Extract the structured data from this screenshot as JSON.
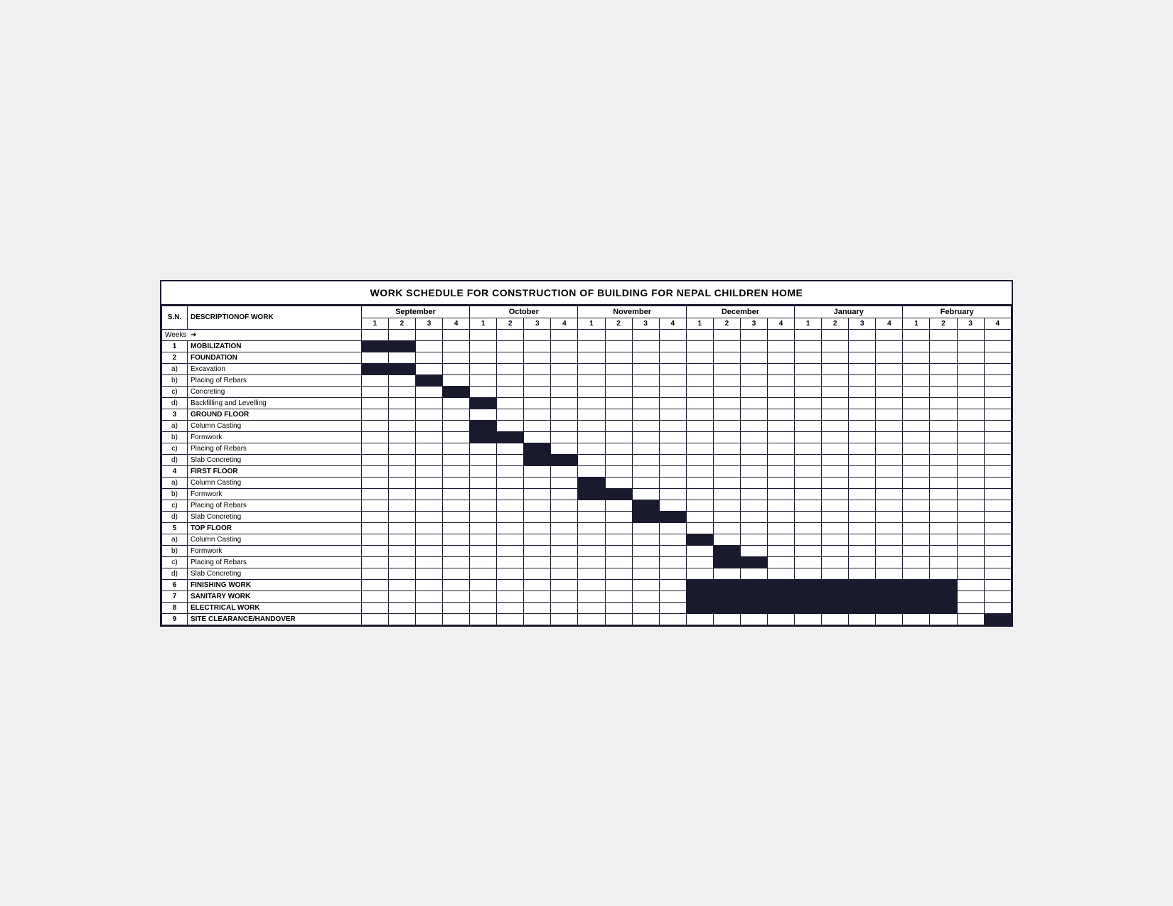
{
  "title": "WORK SCHEDULE FOR CONSTRUCTION OF BUILDING FOR NEPAL CHILDREN HOME",
  "header": {
    "sn_label": "S.N.",
    "desc_label": "DESCRIPTIONOF WORK",
    "weeks_label": "Weeks",
    "months": [
      "September",
      "October",
      "November",
      "December",
      "January",
      "February"
    ],
    "week_numbers": [
      1,
      2,
      3,
      4,
      1,
      2,
      3,
      4,
      1,
      2,
      3,
      4,
      1,
      2,
      3,
      4,
      1,
      2,
      3,
      4,
      1,
      2,
      3,
      4
    ]
  },
  "rows": [
    {
      "sn": "1",
      "desc": "MOBILIZATION",
      "bold": true,
      "bars": [
        1,
        2
      ]
    },
    {
      "sn": "2",
      "desc": "FOUNDATION",
      "bold": true,
      "bars": []
    },
    {
      "sn": "a)",
      "desc": "Excavation",
      "bold": false,
      "bars": [
        1,
        2
      ]
    },
    {
      "sn": "b)",
      "desc": "Placing of Rebars",
      "bold": false,
      "bars": [
        3
      ]
    },
    {
      "sn": "c)",
      "desc": "Concreting",
      "bold": false,
      "bars": [
        4
      ]
    },
    {
      "sn": "d)",
      "desc": "Backfilling and Levelling",
      "bold": false,
      "bars": [
        5
      ]
    },
    {
      "sn": "3",
      "desc": "GROUND FLOOR",
      "bold": true,
      "bars": []
    },
    {
      "sn": "a)",
      "desc": "Column Casting",
      "bold": false,
      "bars": [
        5
      ]
    },
    {
      "sn": "b)",
      "desc": "Formwork",
      "bold": false,
      "bars": [
        5,
        6
      ]
    },
    {
      "sn": "c)",
      "desc": "Placing of Rebars",
      "bold": false,
      "bars": [
        7
      ]
    },
    {
      "sn": "d)",
      "desc": "Slab Concreting",
      "bold": false,
      "bars": [
        7,
        8
      ]
    },
    {
      "sn": "4",
      "desc": "FIRST FLOOR",
      "bold": true,
      "bars": []
    },
    {
      "sn": "a)",
      "desc": "Column Casting",
      "bold": false,
      "bars": [
        9
      ]
    },
    {
      "sn": "b)",
      "desc": "Formwork",
      "bold": false,
      "bars": [
        9,
        10
      ]
    },
    {
      "sn": "c)",
      "desc": "Placing of Rebars",
      "bold": false,
      "bars": [
        11
      ]
    },
    {
      "sn": "d)",
      "desc": "Slab Concreting",
      "bold": false,
      "bars": [
        11,
        12
      ]
    },
    {
      "sn": "5",
      "desc": "TOP FLOOR",
      "bold": true,
      "bars": []
    },
    {
      "sn": "a)",
      "desc": "Column Casting",
      "bold": false,
      "bars": [
        13
      ]
    },
    {
      "sn": "b)",
      "desc": "Formwork",
      "bold": false,
      "bars": [
        14
      ]
    },
    {
      "sn": "c)",
      "desc": "Placing of Rebars",
      "bold": false,
      "bars": [
        14,
        15
      ]
    },
    {
      "sn": "d)",
      "desc": "Slab Concreting",
      "bold": false,
      "bars": []
    },
    {
      "sn": "6",
      "desc": "FINISHING WORK",
      "bold": true,
      "bars": [
        13,
        14,
        15,
        16,
        17,
        18,
        19,
        20,
        21,
        22
      ]
    },
    {
      "sn": "7",
      "desc": "SANITARY WORK",
      "bold": true,
      "bars": [
        13,
        14,
        15,
        16,
        17,
        18,
        19,
        20,
        21,
        22
      ]
    },
    {
      "sn": "8",
      "desc": "ELECTRICAL WORK",
      "bold": true,
      "bars": [
        13,
        14,
        15,
        16,
        17,
        18,
        19,
        20,
        21,
        22
      ]
    },
    {
      "sn": "9",
      "desc": "SITE CLEARANCE/HANDOVER",
      "bold": true,
      "bars": [
        24
      ]
    }
  ]
}
